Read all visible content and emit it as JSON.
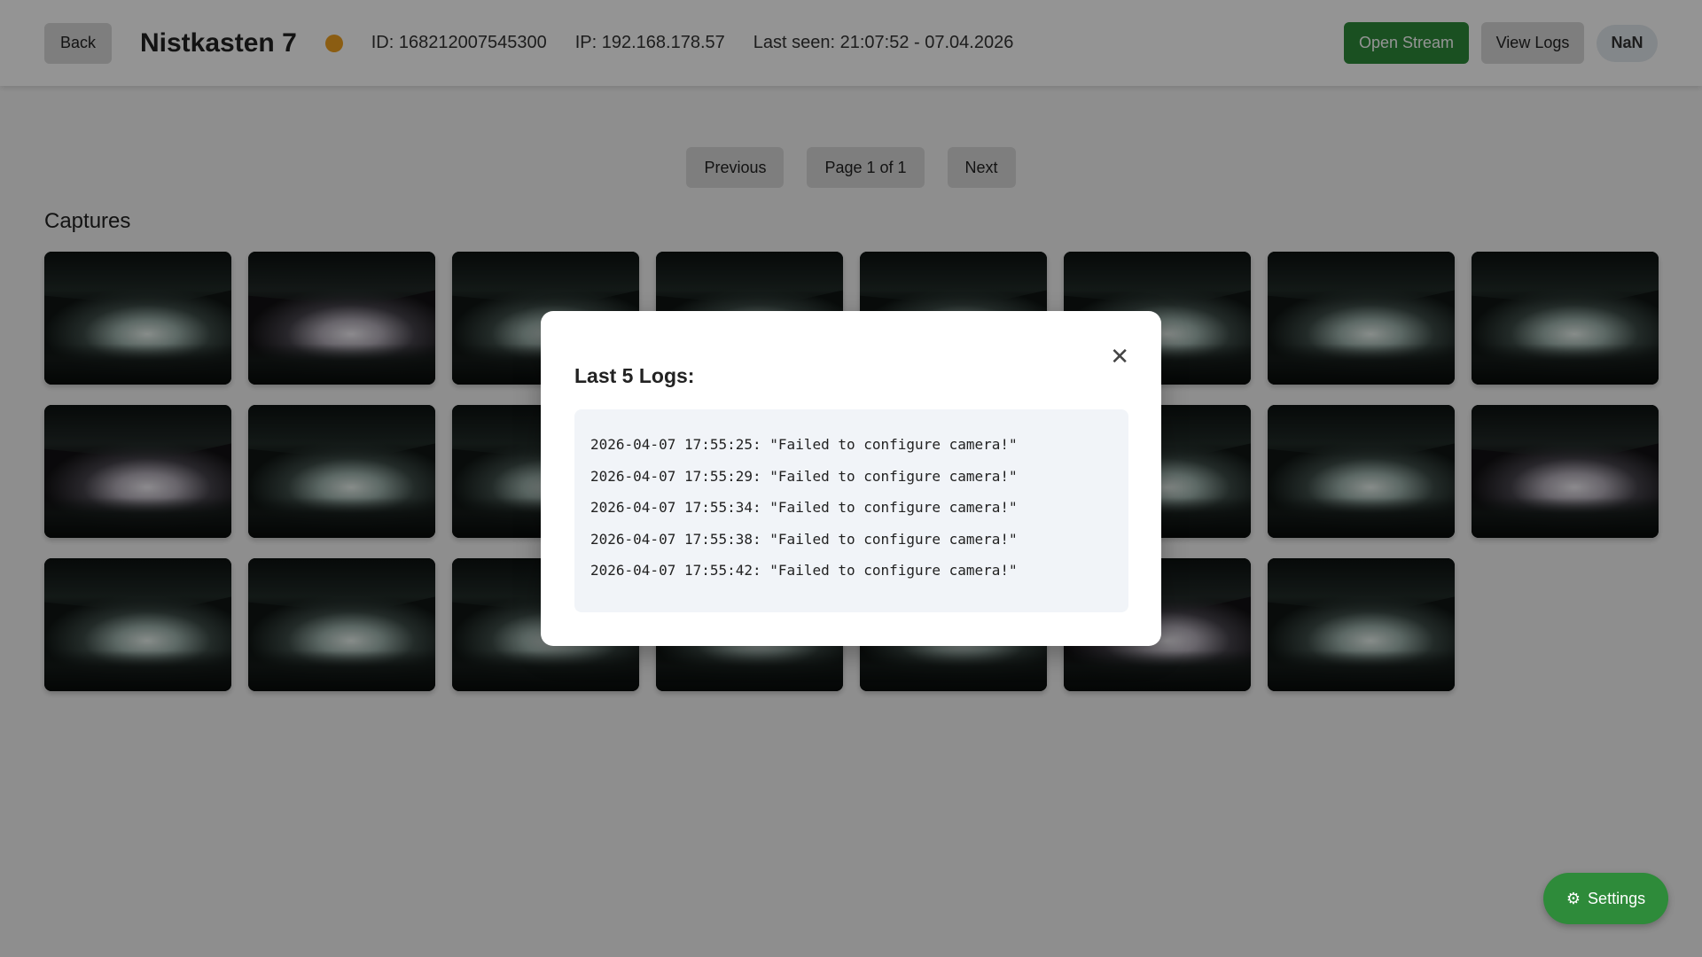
{
  "header": {
    "back_label": "Back",
    "device_name": "Nistkasten 7",
    "status_color": "#f0a020",
    "id_text": "ID: 168212007545300",
    "ip_text": "IP: 192.168.178.57",
    "last_seen_text": "Last seen: 21:07:52 - 07.04.2026",
    "open_stream_label": "Open Stream",
    "view_logs_label": "View Logs",
    "badge_text": "NaN"
  },
  "pagination": {
    "previous_label": "Previous",
    "page_label": "Page 1 of 1",
    "next_label": "Next"
  },
  "captures": {
    "title": "Captures",
    "count": 23
  },
  "settings": {
    "label": "Settings",
    "icon": "gear-icon"
  },
  "modal": {
    "title": "Last 5 Logs:",
    "close_icon": "close-icon",
    "logs": [
      "2026-04-07 17:55:25: \"Failed to configure camera!\"",
      "2026-04-07 17:55:29: \"Failed to configure camera!\"",
      "2026-04-07 17:55:34: \"Failed to configure camera!\"",
      "2026-04-07 17:55:38: \"Failed to configure camera!\"",
      "2026-04-07 17:55:42: \"Failed to configure camera!\""
    ]
  },
  "colors": {
    "accent_green": "#2e8b3a",
    "status_orange": "#f0a020"
  }
}
